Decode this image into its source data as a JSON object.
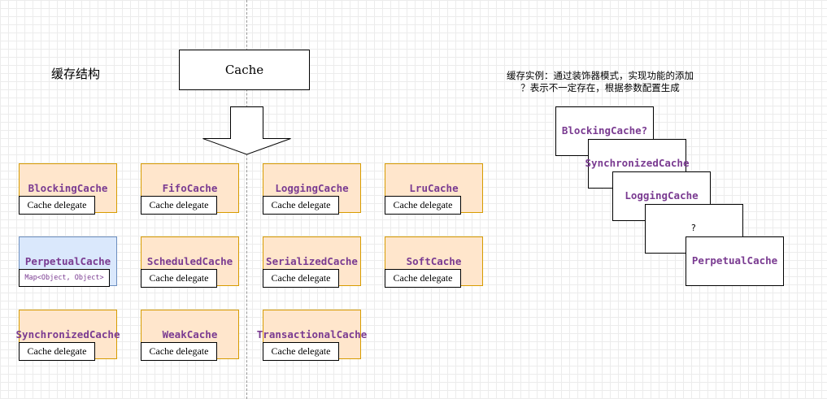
{
  "left_title": "缓存结构",
  "root_box": "Cache",
  "delegate_label": "Cache delegate",
  "map_label": "Map<Object, Object>",
  "cache_grid": [
    "BlockingCache",
    "FifoCache",
    "LoggingCache",
    "LruCache",
    "PerpetualCache",
    "ScheduledCache",
    "SerializedCache",
    "SoftCache",
    "SynchronizedCache",
    "WeakCache",
    "TransactionalCache"
  ],
  "instance_note": {
    "line1": "缓存实例：通过装饰器模式，实现功能的添加",
    "line2": "？表示不一定存在，根据参数配置生成"
  },
  "instance_stack": [
    "BlockingCache?",
    "SynchronizedCache",
    "LoggingCache",
    "?",
    "PerpetualCache"
  ],
  "colors": {
    "card_fill": "#ffe6cc",
    "card_border": "#d79b00",
    "perpetual_fill": "#dae8fc",
    "perpetual_border": "#6c8ebf",
    "class_text": "#7a3b91"
  }
}
